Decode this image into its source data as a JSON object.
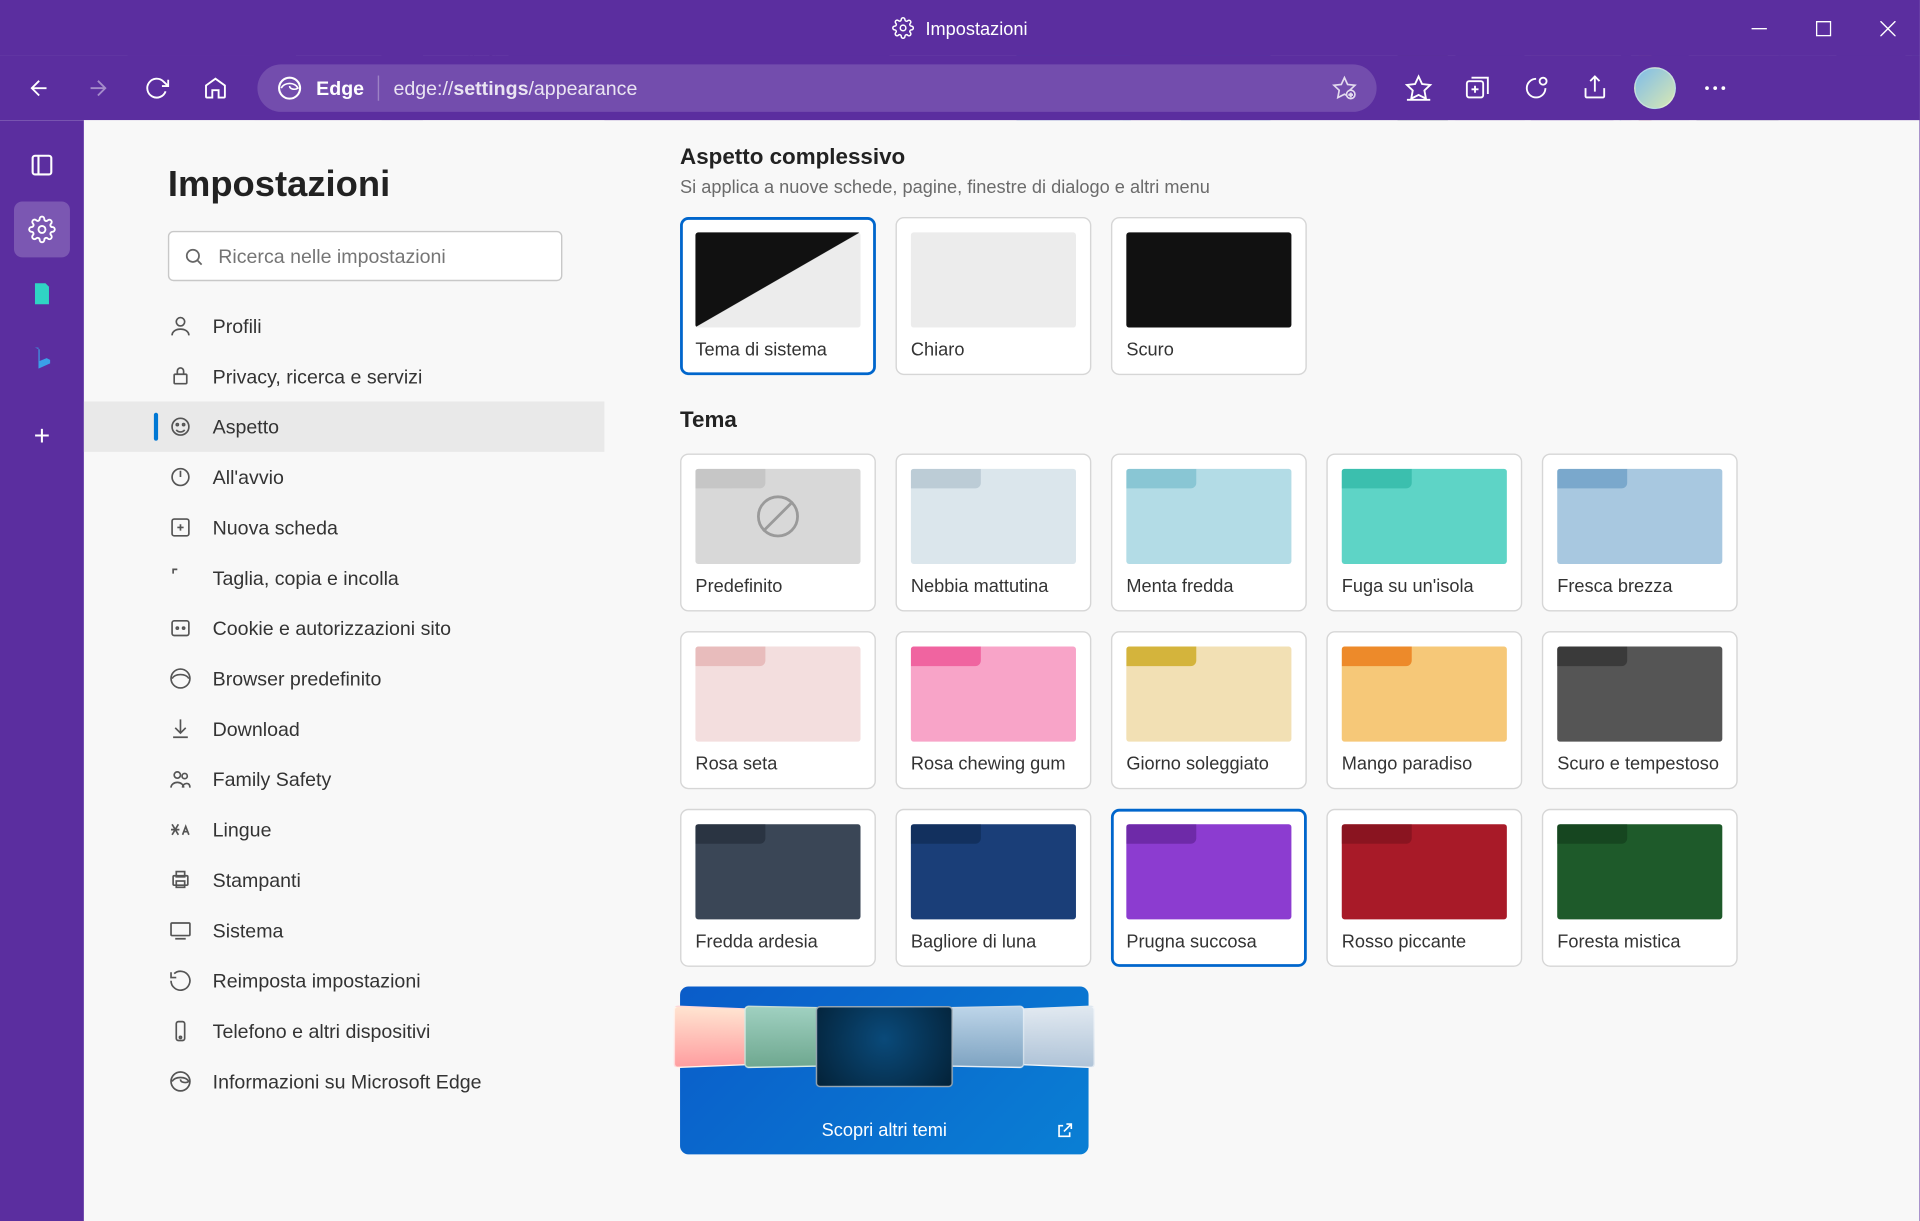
{
  "titlebar": {
    "title": "Impostazioni"
  },
  "toolbar": {
    "brand": "Edge",
    "url_prefix": "edge://",
    "url_bold": "settings",
    "url_suffix": "/appearance"
  },
  "sidebar": {
    "title": "Impostazioni",
    "search_placeholder": "Ricerca nelle impostazioni",
    "items": [
      {
        "label": "Profili"
      },
      {
        "label": "Privacy, ricerca e servizi"
      },
      {
        "label": "Aspetto"
      },
      {
        "label": "All'avvio"
      },
      {
        "label": "Nuova scheda"
      },
      {
        "label": "Taglia, copia e incolla"
      },
      {
        "label": "Cookie e autorizzazioni sito"
      },
      {
        "label": "Browser predefinito"
      },
      {
        "label": "Download"
      },
      {
        "label": "Family Safety"
      },
      {
        "label": "Lingue"
      },
      {
        "label": "Stampanti"
      },
      {
        "label": "Sistema"
      },
      {
        "label": "Reimposta impostazioni"
      },
      {
        "label": "Telefono e altri dispositivi"
      },
      {
        "label": "Informazioni su Microsoft Edge"
      }
    ],
    "active_index": 2
  },
  "content": {
    "section1_title": "Aspetto complessivo",
    "section1_sub": "Si applica a nuove schede, pagine, finestre di dialogo e altri menu",
    "looks": [
      {
        "label": "Tema di sistema",
        "selected": true,
        "key": "system"
      },
      {
        "label": "Chiaro",
        "selected": false,
        "key": "light"
      },
      {
        "label": "Scuro",
        "selected": false,
        "key": "dark"
      }
    ],
    "section2_title": "Tema",
    "themes": [
      {
        "label": "Predefinito",
        "bg": "#d8d8d8",
        "tab": "#c6c6c6",
        "default": true
      },
      {
        "label": "Nebbia mattutina",
        "bg": "#dbe6ec",
        "tab": "#bcccd6"
      },
      {
        "label": "Menta fredda",
        "bg": "#b3dce6",
        "tab": "#89c6d4"
      },
      {
        "label": "Fuga su un'isola",
        "bg": "#5ed4c6",
        "tab": "#3bbfae"
      },
      {
        "label": "Fresca brezza",
        "bg": "#a8c8e0",
        "tab": "#7aa8cc"
      },
      {
        "label": "Rosa seta",
        "bg": "#f3dede",
        "tab": "#e8bcbc"
      },
      {
        "label": "Rosa chewing gum",
        "bg": "#f8a4c8",
        "tab": "#f064a0"
      },
      {
        "label": "Giorno soleggiato",
        "bg": "#f2e0b4",
        "tab": "#d4b43c"
      },
      {
        "label": "Mango paradiso",
        "bg": "#f6c878",
        "tab": "#ed8a2a"
      },
      {
        "label": "Scuro e tempestoso",
        "bg": "#555555",
        "tab": "#3a3a3a"
      },
      {
        "label": "Fredda ardesia",
        "bg": "#3a4656",
        "tab": "#2a3442"
      },
      {
        "label": "Bagliore di luna",
        "bg": "#1a3e78",
        "tab": "#12305e"
      },
      {
        "label": "Prugna succosa",
        "bg": "#8c3cd0",
        "tab": "#6e2aa8",
        "selected": true
      },
      {
        "label": "Rosso piccante",
        "bg": "#a81a28",
        "tab": "#8a1420"
      },
      {
        "label": "Foresta mistica",
        "bg": "#1e5a2a",
        "tab": "#164620"
      }
    ],
    "discover_label": "Scopri altri temi"
  }
}
